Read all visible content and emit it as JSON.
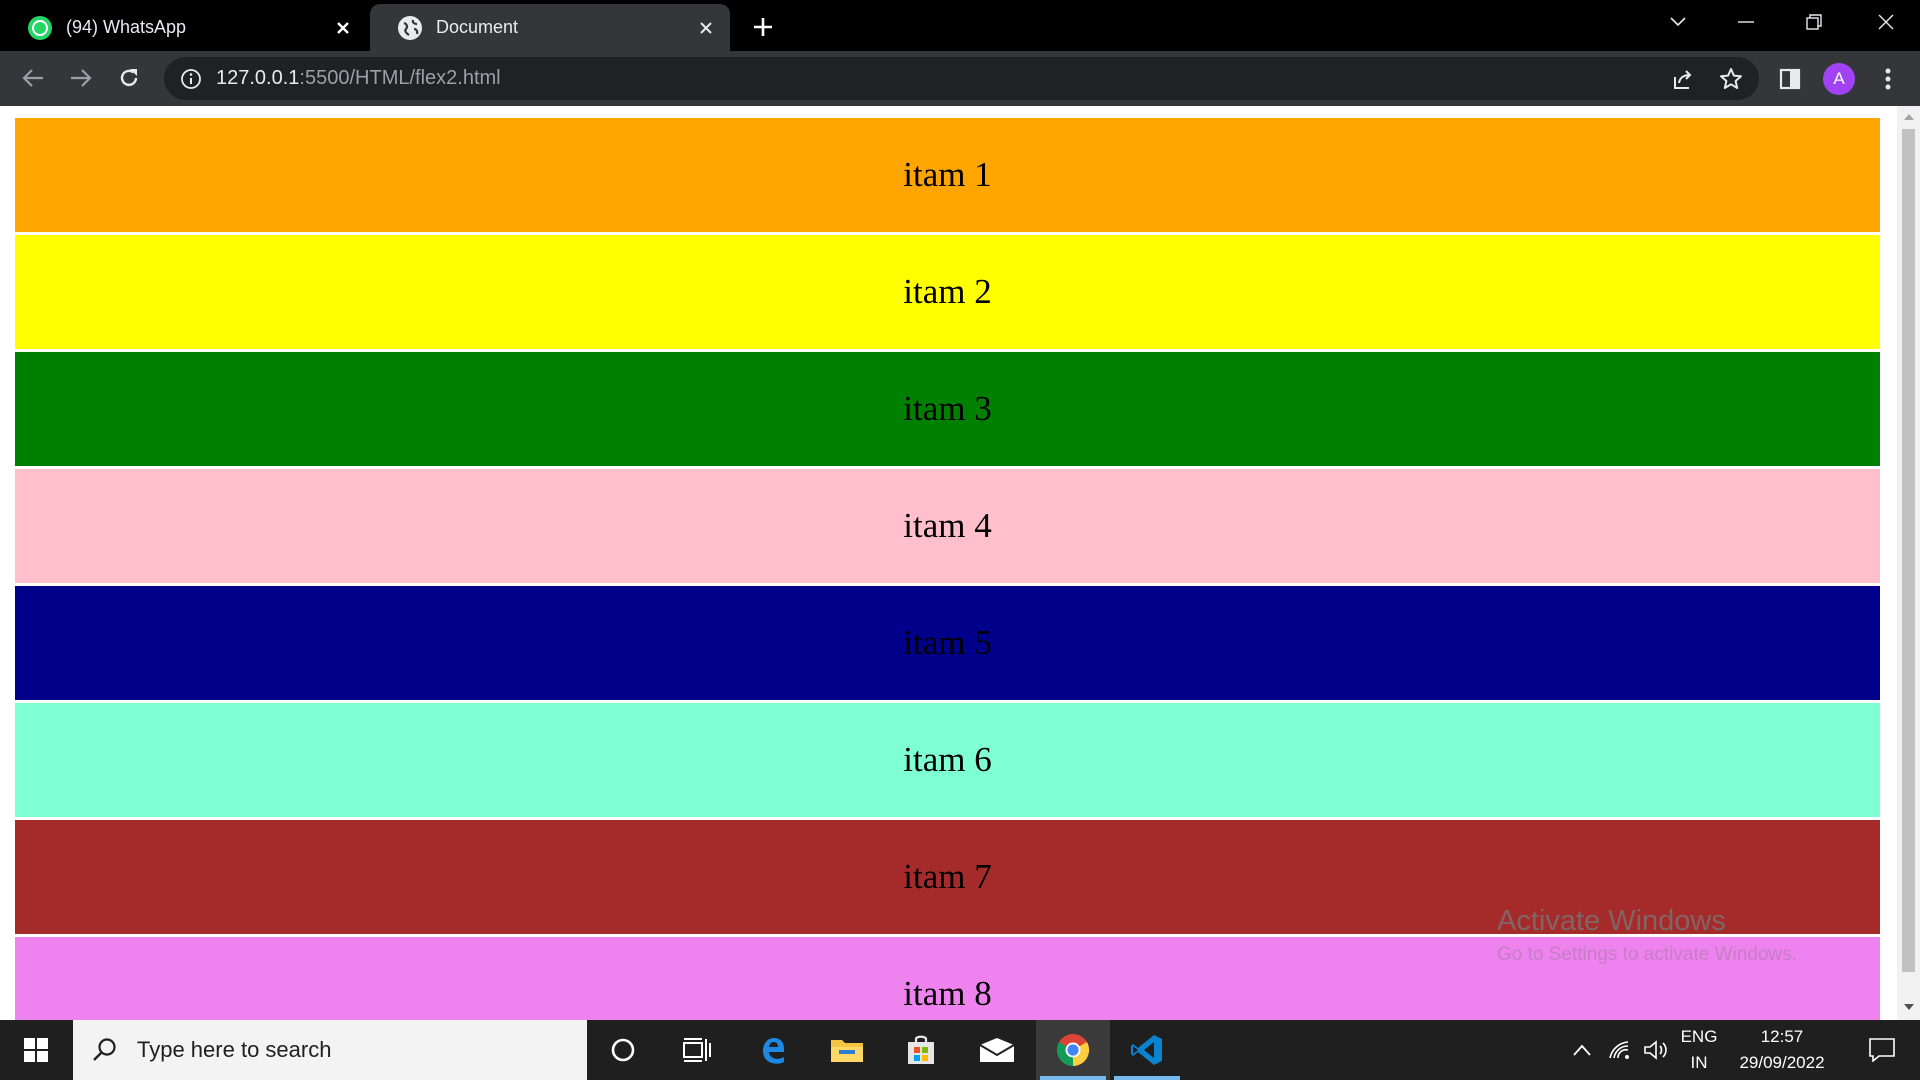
{
  "browser": {
    "tabs": [
      {
        "title": "(94) WhatsApp",
        "badge": "94",
        "icon": "whatsapp-icon"
      },
      {
        "title": "Document",
        "icon": "globe-icon"
      }
    ],
    "address": {
      "host": "127.0.0.1",
      "rest": ":5500/HTML/flex2.html"
    },
    "profile_initial": "A"
  },
  "page": {
    "items": [
      {
        "label": "itam 1",
        "color": "#ffa500"
      },
      {
        "label": "itam 2",
        "color": "#ffff00"
      },
      {
        "label": "itam 3",
        "color": "#008000"
      },
      {
        "label": "itam 4",
        "color": "#ffc0cb"
      },
      {
        "label": "itam 5",
        "color": "#00008b"
      },
      {
        "label": "itam 6",
        "color": "#7fffd4"
      },
      {
        "label": "itam 7",
        "color": "#a52a2a"
      },
      {
        "label": "itam 8",
        "color": "#ee82ee"
      }
    ]
  },
  "watermark": {
    "title": "Activate Windows",
    "subtitle": "Go to Settings to activate Windows."
  },
  "taskbar": {
    "search_placeholder": "Type here to search",
    "language": "ENG",
    "region": "IN",
    "time": "12:57",
    "date": "29/09/2022"
  }
}
